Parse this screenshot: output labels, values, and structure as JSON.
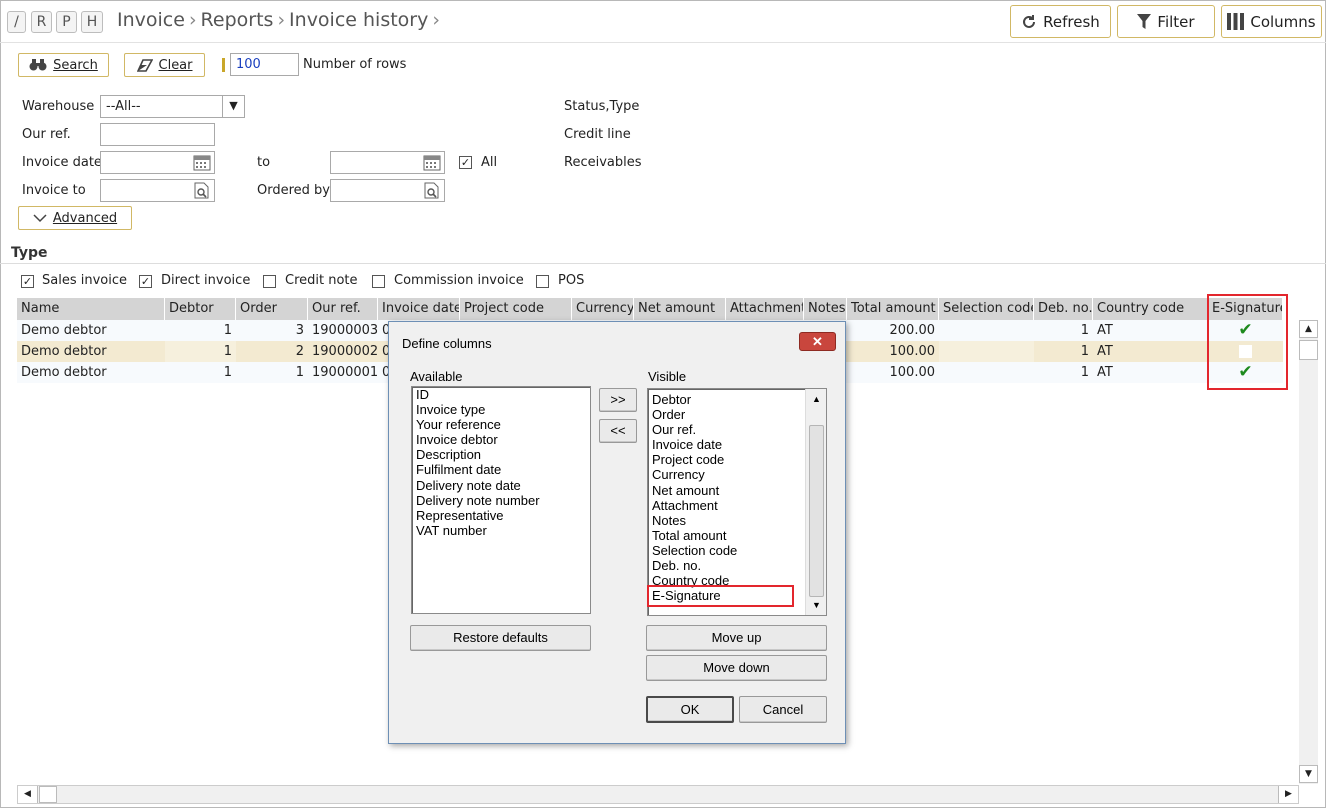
{
  "nav_letters": [
    "/",
    "R",
    "P",
    "H"
  ],
  "breadcrumb": [
    "Invoice",
    "Reports",
    "Invoice history"
  ],
  "toolbar": {
    "refresh": "Refresh",
    "filter": "Filter",
    "columns": "Columns"
  },
  "search": {
    "search_label": "Search",
    "clear_label": "Clear",
    "rows_value": "100",
    "rows_label": "Number of rows"
  },
  "filters": {
    "warehouse_label": "Warehouse",
    "warehouse_value": "--All--",
    "our_ref_label": "Our ref.",
    "invoice_date_label": "Invoice date",
    "to_label": "to",
    "all_label": "All",
    "invoice_to_label": "Invoice to",
    "ordered_by_label": "Ordered by",
    "status_type_label": "Status,Type",
    "credit_line_label": "Credit line",
    "receivables_label": "Receivables",
    "advanced_label": "Advanced"
  },
  "type_section": {
    "title": "Type",
    "options": [
      {
        "label": "Sales invoice",
        "checked": true
      },
      {
        "label": "Direct invoice",
        "checked": true
      },
      {
        "label": "Credit note",
        "checked": false
      },
      {
        "label": "Commission invoice",
        "checked": false
      },
      {
        "label": "POS",
        "checked": false
      }
    ]
  },
  "grid": {
    "headers": [
      "Name",
      "Debtor",
      "Order",
      "Our ref.",
      "Invoice date",
      "Project code",
      "Currency",
      "Net amount",
      "Attachment",
      "Notes",
      "Total amount",
      "Selection code",
      "Deb. no.",
      "Country code",
      "E-Signature"
    ],
    "rows": [
      {
        "name": "Demo debtor",
        "debtor": "1",
        "order": "3",
        "our_ref": "19000003",
        "inv_date": "0",
        "total": "200.00",
        "deb_no": "1",
        "country": "AT",
        "esig": "✔"
      },
      {
        "name": "Demo debtor",
        "debtor": "1",
        "order": "2",
        "our_ref": "19000002",
        "inv_date": "0",
        "total": "100.00",
        "deb_no": "1",
        "country": "AT",
        "esig": ""
      },
      {
        "name": "Demo debtor",
        "debtor": "1",
        "order": "1",
        "our_ref": "19000001",
        "inv_date": "0",
        "total": "100.00",
        "deb_no": "1",
        "country": "AT",
        "esig": "✔"
      }
    ]
  },
  "dialog": {
    "title": "Define columns",
    "close": "✕",
    "available_label": "Available",
    "visible_label": "Visible",
    "available": [
      "ID",
      "Invoice type",
      "Your reference",
      "Invoice debtor",
      "Description",
      "Fulfilment date",
      "Delivery note date",
      "Delivery note number",
      "Representative",
      "VAT number"
    ],
    "visible": [
      "Debtor",
      "Order",
      "Our ref.",
      "Invoice date",
      "Project code",
      "Currency",
      "Net amount",
      "Attachment",
      "Notes",
      "Total amount",
      "Selection code",
      "Deb. no.",
      "Country code",
      "E-Signature"
    ],
    "add_btn": ">>",
    "remove_btn": "<<",
    "restore": "Restore defaults",
    "move_up": "Move up",
    "move_down": "Move down",
    "ok": "OK",
    "cancel": "Cancel"
  },
  "colors": {
    "accent_border": "#d1b865",
    "highlight_red": "#e3262d",
    "row_alt": "#f3ead1",
    "check_green": "#1e8a1e"
  }
}
